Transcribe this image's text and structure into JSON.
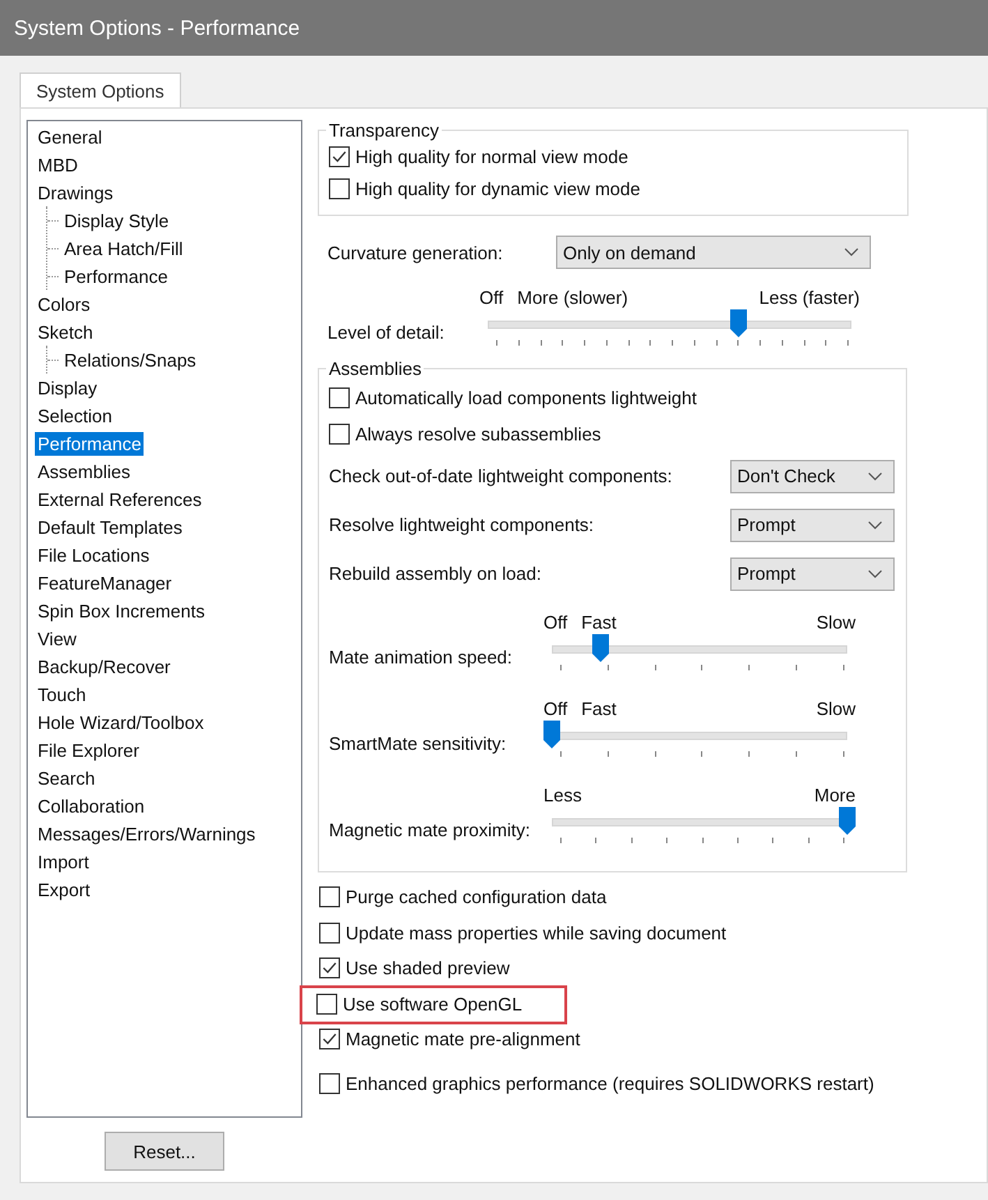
{
  "window": {
    "title": "System Options - Performance"
  },
  "tabs": [
    {
      "label": "System Options",
      "selected": true
    }
  ],
  "sidebar": {
    "items": [
      {
        "label": "General",
        "selected": false
      },
      {
        "label": "MBD",
        "selected": false
      },
      {
        "label": "Drawings",
        "selected": false,
        "children": [
          {
            "label": "Display Style",
            "selected": false
          },
          {
            "label": "Area Hatch/Fill",
            "selected": false
          },
          {
            "label": "Performance",
            "selected": false
          }
        ]
      },
      {
        "label": "Colors",
        "selected": false
      },
      {
        "label": "Sketch",
        "selected": false,
        "children": [
          {
            "label": "Relations/Snaps",
            "selected": false
          }
        ]
      },
      {
        "label": "Display",
        "selected": false
      },
      {
        "label": "Selection",
        "selected": false
      },
      {
        "label": "Performance",
        "selected": true
      },
      {
        "label": "Assemblies",
        "selected": false
      },
      {
        "label": "External References",
        "selected": false
      },
      {
        "label": "Default Templates",
        "selected": false
      },
      {
        "label": "File Locations",
        "selected": false
      },
      {
        "label": "FeatureManager",
        "selected": false
      },
      {
        "label": "Spin Box Increments",
        "selected": false
      },
      {
        "label": "View",
        "selected": false
      },
      {
        "label": "Backup/Recover",
        "selected": false
      },
      {
        "label": "Touch",
        "selected": false
      },
      {
        "label": "Hole Wizard/Toolbox",
        "selected": false
      },
      {
        "label": "File Explorer",
        "selected": false
      },
      {
        "label": "Search",
        "selected": false
      },
      {
        "label": "Collaboration",
        "selected": false
      },
      {
        "label": "Messages/Errors/Warnings",
        "selected": false
      },
      {
        "label": "Import",
        "selected": false
      },
      {
        "label": "Export",
        "selected": false
      }
    ]
  },
  "transparency": {
    "title": "Transparency",
    "options": [
      {
        "label": "High quality for normal view mode",
        "checked": true
      },
      {
        "label": "High quality for dynamic view mode",
        "checked": false
      }
    ]
  },
  "curvature_generation": {
    "label": "Curvature generation:",
    "value": "Only on demand"
  },
  "level_of_detail": {
    "label": "Level of detail:",
    "scale_labels": [
      "Off",
      "More (slower)",
      "Less (faster)"
    ],
    "level": 0.69
  },
  "assemblies": {
    "title": "Assemblies",
    "items": [
      {
        "kind": "checkbox",
        "label": "Automatically load components lightweight",
        "checked": false
      },
      {
        "kind": "checkbox",
        "label": "Always resolve subassemblies",
        "checked": false
      },
      {
        "kind": "dropdown",
        "label": "Check out-of-date lightweight components:",
        "value": "Don't Check"
      },
      {
        "kind": "dropdown",
        "label": "Resolve lightweight components:",
        "value": "Prompt"
      },
      {
        "kind": "dropdown",
        "label": "Rebuild assembly on load:",
        "value": "Prompt"
      },
      {
        "kind": "slider",
        "label": "Mate animation speed:",
        "scale_labels": [
          "Off",
          "Fast",
          "Slow"
        ],
        "level": 0.167
      },
      {
        "kind": "slider",
        "label": "SmartMate sensitivity:",
        "scale_labels": [
          "Off",
          "Fast",
          "Slow"
        ],
        "level": 0
      },
      {
        "kind": "slider",
        "label": "Magnetic mate proximity:",
        "scale_labels": [
          "Less",
          "More"
        ],
        "level": 1
      }
    ]
  },
  "options": [
    {
      "label": "Purge cached configuration data",
      "checked": false,
      "highlighted": false
    },
    {
      "label": "Update mass properties while saving document",
      "checked": false,
      "highlighted": false
    },
    {
      "label": "Use shaded preview",
      "checked": true,
      "highlighted": false
    },
    {
      "label": "Use software OpenGL",
      "checked": false,
      "highlighted": true
    },
    {
      "label": "Magnetic mate pre-alignment",
      "checked": true,
      "highlighted": false
    },
    {
      "label": "Enhanced graphics performance (requires SOLIDWORKS restart)",
      "checked": false,
      "highlighted": false
    }
  ],
  "buttons": [
    {
      "label": "Reset..."
    }
  ]
}
